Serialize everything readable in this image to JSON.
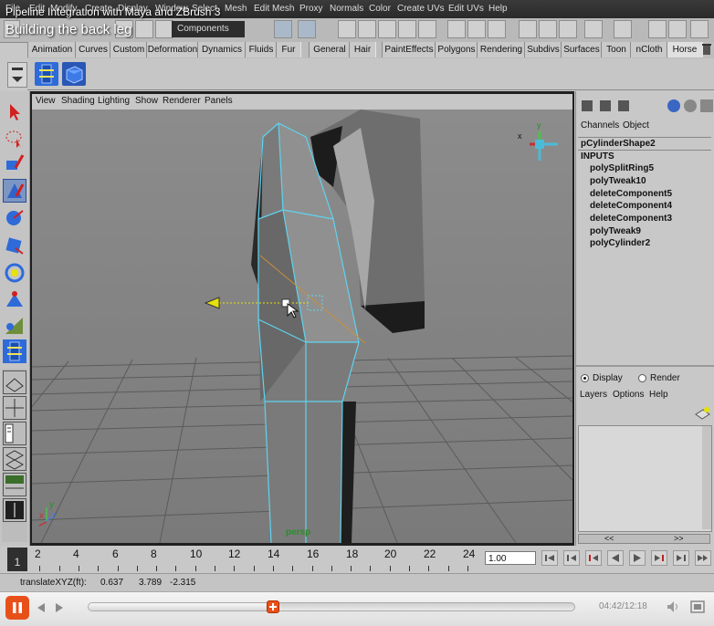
{
  "overlay": {
    "title": "Pipeline Integration with Maya and ZBrush 3",
    "subtitle": "Building the back leg"
  },
  "menubar": {
    "items": [
      "File",
      "Edit",
      "Modify",
      "Create",
      "Display",
      "Window",
      "Select",
      "Mesh",
      "Edit Mesh",
      "Proxy",
      "Normals",
      "Color",
      "Create UVs",
      "Edit UVs",
      "Help"
    ]
  },
  "statusline": {
    "mode": "Components"
  },
  "shelf": {
    "tabs": [
      "Animation",
      "Curves",
      "Custom",
      "Deformation",
      "Dynamics",
      "Fluids",
      "Fur",
      "General",
      "Hair",
      "PaintEffects",
      "Polygons",
      "Rendering",
      "Subdivs",
      "Surfaces",
      "Toon",
      "nCloth",
      "Horse"
    ]
  },
  "viewport": {
    "menus": [
      "View",
      "Shading",
      "Lighting",
      "Show",
      "Renderer",
      "Panels"
    ],
    "camera_label": "persp",
    "axis_x": "x",
    "axis_y": "y",
    "axis_z": "z"
  },
  "channel_box": {
    "tabs": [
      "Channels",
      "Object"
    ],
    "shape_name": "pCylinderShape2",
    "inputs_header": "INPUTS",
    "inputs": [
      "polySplitRing5",
      "polyTweak10",
      "deleteComponent5",
      "deleteComponent4",
      "deleteComponent3",
      "polyTweak9",
      "polyCylinder2"
    ],
    "layer_display": "Display",
    "layer_render": "Render",
    "layer_menus": [
      "Layers",
      "Options",
      "Help"
    ],
    "scroll_left": "<<",
    "scroll_right": ">>"
  },
  "timeline": {
    "current_frame": "1",
    "ticks": [
      "2",
      "4",
      "6",
      "8",
      "10",
      "12",
      "14",
      "16",
      "18",
      "20",
      "22",
      "24"
    ],
    "frame_field": "1.00"
  },
  "helpline": {
    "label": "translateXYZ(ft):",
    "x": "0.637",
    "y": "3.789",
    "z": "-2.315"
  },
  "player": {
    "time": "04:42/12:18",
    "progress_fraction": 0.381
  },
  "colors": {
    "wire_highlight": "#5fd3f0",
    "pause_button": "#e8501a",
    "move_handle": "#e6e20a"
  }
}
